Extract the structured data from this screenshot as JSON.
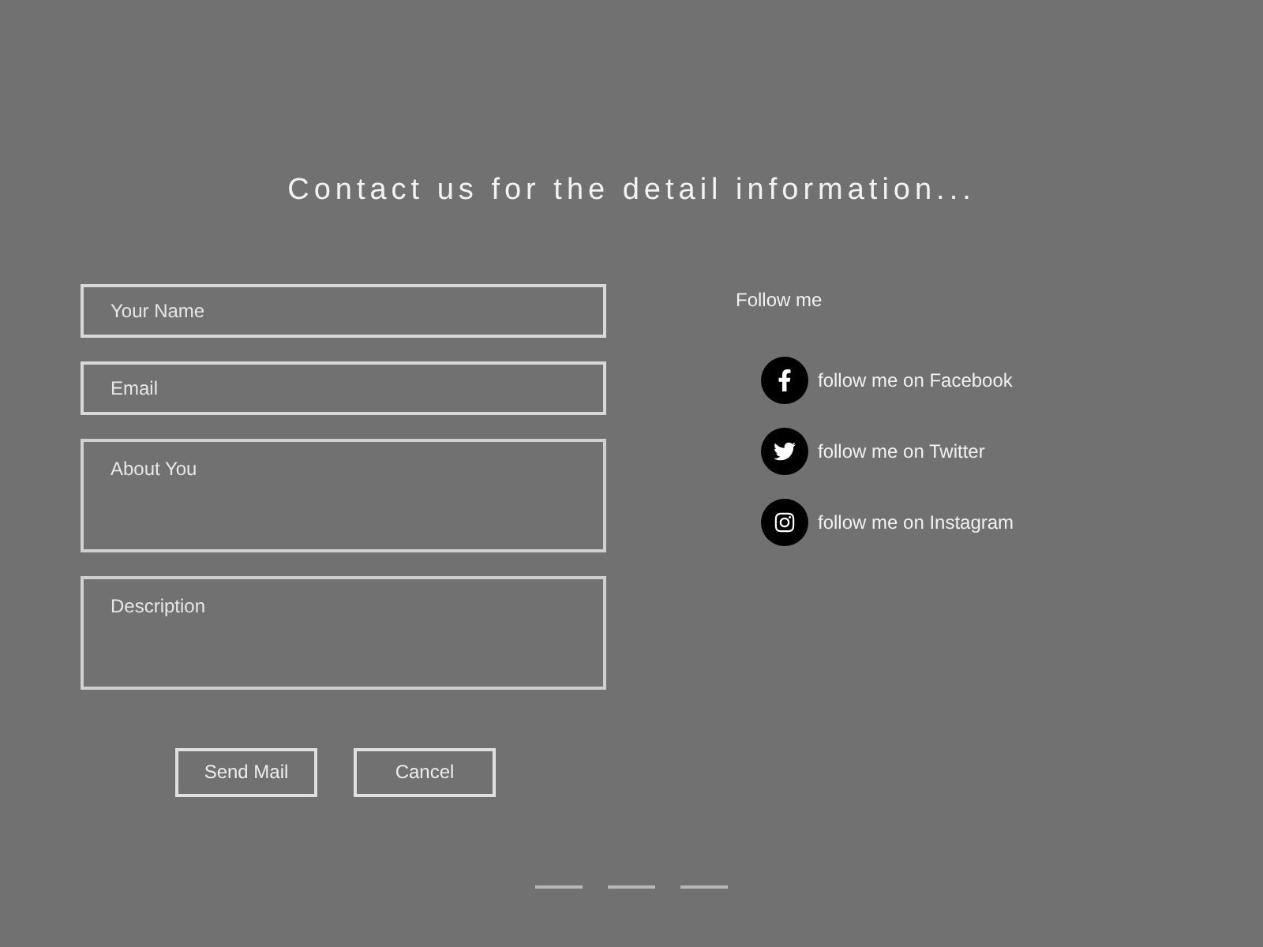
{
  "heading": "Contact us for the detail information...",
  "form": {
    "fields": [
      {
        "kind": "line",
        "placeholder": "Your Name"
      },
      {
        "kind": "line",
        "placeholder": "Email"
      },
      {
        "kind": "area",
        "placeholder": "About You"
      },
      {
        "kind": "area",
        "placeholder": "Description"
      }
    ],
    "buttons": [
      "Send Mail",
      "Cancel"
    ]
  },
  "follow": {
    "title": "Follow me",
    "links": [
      {
        "kind": "facebook",
        "label": "follow me on Facebook"
      },
      {
        "kind": "twitter",
        "label": "follow me on Twitter"
      },
      {
        "kind": "instagram",
        "label": "follow me on Instagram"
      }
    ]
  }
}
